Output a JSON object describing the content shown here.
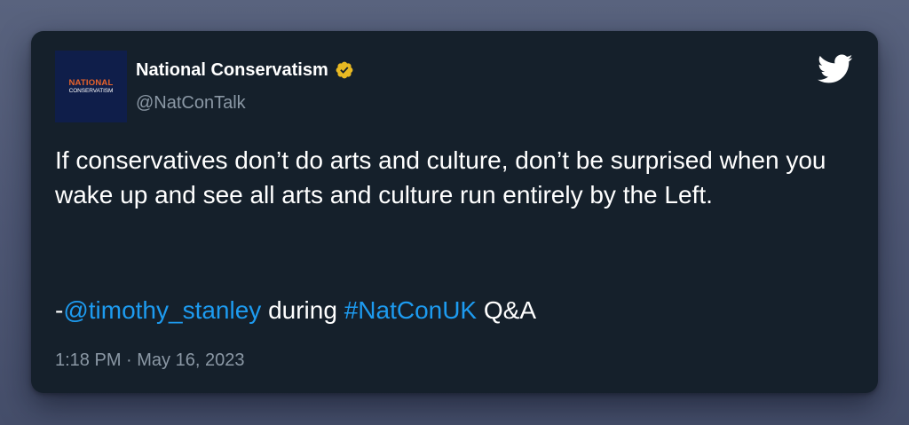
{
  "tweet": {
    "author": {
      "display_name": "National Conservatism",
      "handle": "@NatConTalk",
      "verified": true,
      "avatar": {
        "line1": "NATIONAL",
        "line2": "CONSERVATISM"
      }
    },
    "text": "If conservatives don’t do arts and culture, don’t be surprised when you wake up and see all arts and culture run entirely by the Left.",
    "attribution": {
      "prefix": "-",
      "mention": "@timothy_stanley",
      "middle": " during ",
      "hashtag": "#NatConUK",
      "suffix": " Q&A"
    },
    "timestamp": "1:18 PM · May 16, 2023"
  },
  "icons": {
    "verified": "verified-badge-icon",
    "brand": "twitter-bird-icon"
  },
  "colors": {
    "card_background": "#15202b",
    "link": "#1d9bf0",
    "secondary_text": "#8b98a5",
    "verified_badge": "#e8b923",
    "avatar_background": "#0f1e4a",
    "avatar_accent": "#e8632b"
  }
}
